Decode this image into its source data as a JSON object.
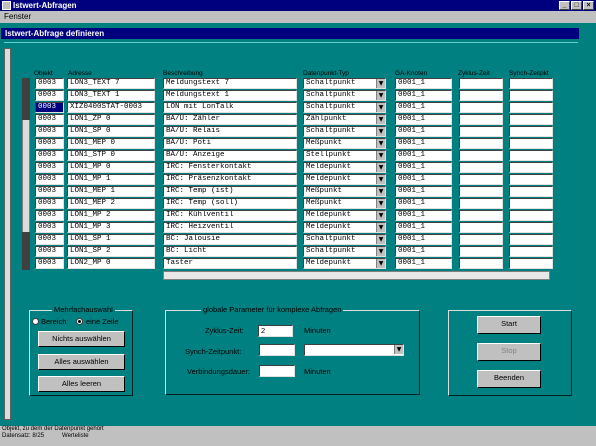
{
  "window": {
    "title": "Istwert-Abfragen",
    "btn_min": "_",
    "btn_max": "□",
    "btn_close": "×"
  },
  "menu": {
    "fenster": "Fenster"
  },
  "child": {
    "title": "Istwert-Abfrage definieren"
  },
  "columns": {
    "objekt": "Objekt",
    "adresse": "Adresse",
    "beschreibung": "Beschreibung",
    "typ": "Datenpunkt-Typ",
    "ga": "GA-Knoten",
    "zyklus": "Zyklus-Zeit",
    "synch": "Synch-Zeitpkt"
  },
  "rows": [
    {
      "objekt": "0003",
      "adresse": "LON3_TEXT 7",
      "beschreibung": "Meldungstext 7",
      "typ": "Schaltpunkt",
      "ga": "0001_1"
    },
    {
      "objekt": "0003",
      "adresse": "LON3_TEXT 1",
      "beschreibung": "Meldungstext 1",
      "typ": "Schaltpunkt",
      "ga": "0001_1"
    },
    {
      "objekt": "0003",
      "adresse": "XIZ0400STAT-0003",
      "beschreibung": "LON mit LonTalk",
      "typ": "Schaltpunkt",
      "ga": "0001_1"
    },
    {
      "objekt": "0003",
      "adresse": "LON1_ZP 0",
      "beschreibung": "BA/U: Zähler",
      "typ": "Zählpunkt",
      "ga": "0001_1"
    },
    {
      "objekt": "0003",
      "adresse": "LON1_SP 0",
      "beschreibung": "BA/U: Relais",
      "typ": "Schaltpunkt",
      "ga": "0001_1"
    },
    {
      "objekt": "0003",
      "adresse": "LON1_MEP 0",
      "beschreibung": "BA/U: Poti",
      "typ": "Meßpunkt",
      "ga": "0001_1"
    },
    {
      "objekt": "0003",
      "adresse": "LON1_STP 0",
      "beschreibung": "BA/U: Anzeige",
      "typ": "Stellpunkt",
      "ga": "0001_1"
    },
    {
      "objekt": "0003",
      "adresse": "LON1_MP 0",
      "beschreibung": "IRC: Fensterkontakt",
      "typ": "Meldepunkt",
      "ga": "0001_1"
    },
    {
      "objekt": "0003",
      "adresse": "LON1_MP 1",
      "beschreibung": "IRC: Präsenzkontakt",
      "typ": "Meldepunkt",
      "ga": "0001_1"
    },
    {
      "objekt": "0003",
      "adresse": "LON1_MEP 1",
      "beschreibung": "IRC: Temp (ist)",
      "typ": "Meßpunkt",
      "ga": "0001_1"
    },
    {
      "objekt": "0003",
      "adresse": "LON1_MEP 2",
      "beschreibung": "IRC: Temp (soll)",
      "typ": "Meßpunkt",
      "ga": "0001_1"
    },
    {
      "objekt": "0003",
      "adresse": "LON1_MP 2",
      "beschreibung": "IRC: Kühlventil",
      "typ": "Meldepunkt",
      "ga": "0001_1"
    },
    {
      "objekt": "0003",
      "adresse": "LON1_MP 3",
      "beschreibung": "IRC: Heizventil",
      "typ": "Meldepunkt",
      "ga": "0001_1"
    },
    {
      "objekt": "0003",
      "adresse": "LON1_SP 1",
      "beschreibung": "BC: Jalousie",
      "typ": "Schaltpunkt",
      "ga": "0001_1"
    },
    {
      "objekt": "0003",
      "adresse": "LON1_SP 2",
      "beschreibung": "BC: Licht",
      "typ": "Schaltpunkt",
      "ga": "0001_1"
    },
    {
      "objekt": "0003",
      "adresse": "LON2_MP 0",
      "beschreibung": "Taster",
      "typ": "Meldepunkt",
      "ga": "0001_1"
    }
  ],
  "mehrfach": {
    "title": "Mehrfachauswahl",
    "bereich": "Bereich",
    "eine_zeile": "eine Zeile",
    "nichts": "Nichts auswählen",
    "alles": "Alles auswählen",
    "leeren": "Alles leeren"
  },
  "global": {
    "title": "globale Parameter für komplexe Abfragen",
    "zyklus_label": "Zyklus-Zeit:",
    "zyklus_value": "2",
    "zyklus_unit": "Minuten",
    "synch_label": "Synch-Zeitpunkt:",
    "verbindung_label": "Verbindungsdauer:",
    "verbindung_unit": "Minuten"
  },
  "actions": {
    "start": "Start",
    "stop": "Stop",
    "beenden": "Beenden"
  },
  "status": {
    "line1": "Objekt, zu dem der Datenpunkt gehört",
    "line2a": "Datensatz: 8/25",
    "line2b": "Werteliste"
  },
  "icons": {
    "dropdown": "▼"
  }
}
